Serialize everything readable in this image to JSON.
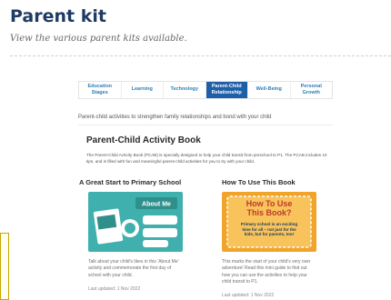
{
  "header": {
    "title": "Parent kit",
    "subtitle": "View the various parent kits available."
  },
  "tabs": [
    {
      "label": "Education Stages",
      "active": false
    },
    {
      "label": "Learning",
      "active": false
    },
    {
      "label": "Technology",
      "active": false
    },
    {
      "label": "Parent-Child Relationship",
      "active": true
    },
    {
      "label": "Well-Being",
      "active": false
    },
    {
      "label": "Personal Growth",
      "active": false
    }
  ],
  "intro": "Parent-child activities to strengthen family relationships and bond with your child",
  "section": {
    "title": "Parent-Child Activity Book",
    "description": "The Parent-Child Activity Book (PCAB) is specially designed to help your child transit from preschool to P1. The PCAB includes 10 tips, and is filled with fun and meaningful parent-child activities for you to try with your child."
  },
  "cards": [
    {
      "title": "A Great Start to Primary School",
      "thumb_heading": "About Me",
      "text": "Talk about your child's likes in this 'About Me' activity and commemorate the first day of school with your child.",
      "date": "Last updated: 1 Nov 2022"
    },
    {
      "title": "How To Use This Book",
      "thumb_heading": "How To Use This Book?",
      "thumb_body": "Primary school is an exciting time for all – not just for the kids, but for parents, too!",
      "text": "This marks the start of your child's very own adventure! Read this mini guide to find out how you can use the activities to help your child transit to P1.",
      "date": "Last updated: 1 Nov 2022"
    }
  ],
  "colors": {
    "title": "#1f3b63",
    "tab_active": "#1f5fa8",
    "tab_text": "#2c7fb8",
    "thumb_teal": "#3fb0ad",
    "thumb_orange": "#f2a32a"
  }
}
